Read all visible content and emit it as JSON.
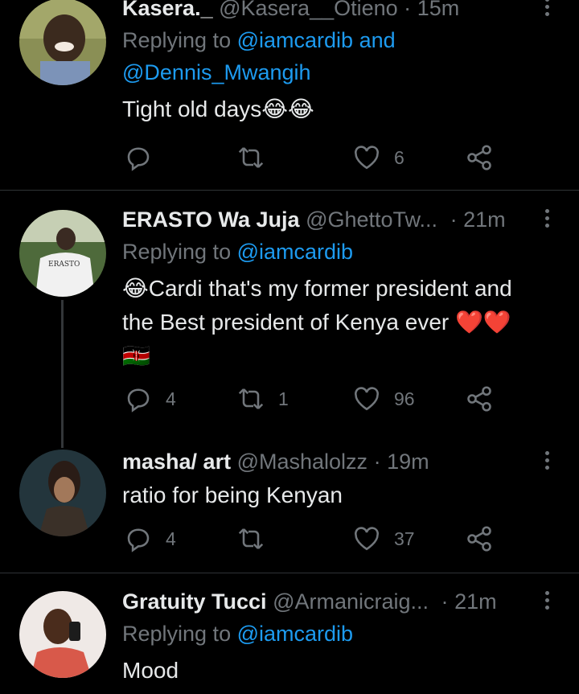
{
  "tweets": [
    {
      "name": "Kasera._",
      "handle": "@Kasera__Otieno",
      "dot": "·",
      "time": "15m",
      "replying_prefix": "Replying to",
      "replying_to": "@iamcardib and @Dennis_Mwangih",
      "replying_line1": "@iamcardib and",
      "replying_line2": "@Dennis_Mwangih",
      "text": "Tight old days😂😂",
      "reply_count": "",
      "retweet_count": "",
      "like_count": "6"
    },
    {
      "name": "ERASTO Wa Juja",
      "handle": "@GhettoTw...",
      "dot": "·",
      "time": "21m",
      "replying_prefix": "Replying to",
      "replying_to": "@iamcardib",
      "text_line1": "😂Cardi that's my former president and",
      "text_line2": "the Best president of Kenya ever ❤️❤️",
      "text_line3": "🇰🇪",
      "reply_count": "4",
      "retweet_count": "1",
      "like_count": "96"
    },
    {
      "name": "masha/ art",
      "handle": "@Mashalolzz",
      "dot": "·",
      "time": "19m",
      "text": "ratio for being Kenyan",
      "reply_count": "4",
      "retweet_count": "",
      "like_count": "37"
    },
    {
      "name": "Gratuity Tucci",
      "handle": "@Armanicraig...",
      "dot": "·",
      "time": "21m",
      "replying_prefix": "Replying to",
      "replying_to": "@iamcardib",
      "text": "Mood"
    }
  ],
  "icons": {
    "reply": "reply-icon",
    "retweet": "retweet-icon",
    "like": "heart-icon",
    "share": "share-icon",
    "more": "more-icon"
  },
  "colors": {
    "background": "#000000",
    "text": "#e7e9ea",
    "muted": "#71767b",
    "link": "#1d9bf0",
    "divider": "#2f3336"
  }
}
